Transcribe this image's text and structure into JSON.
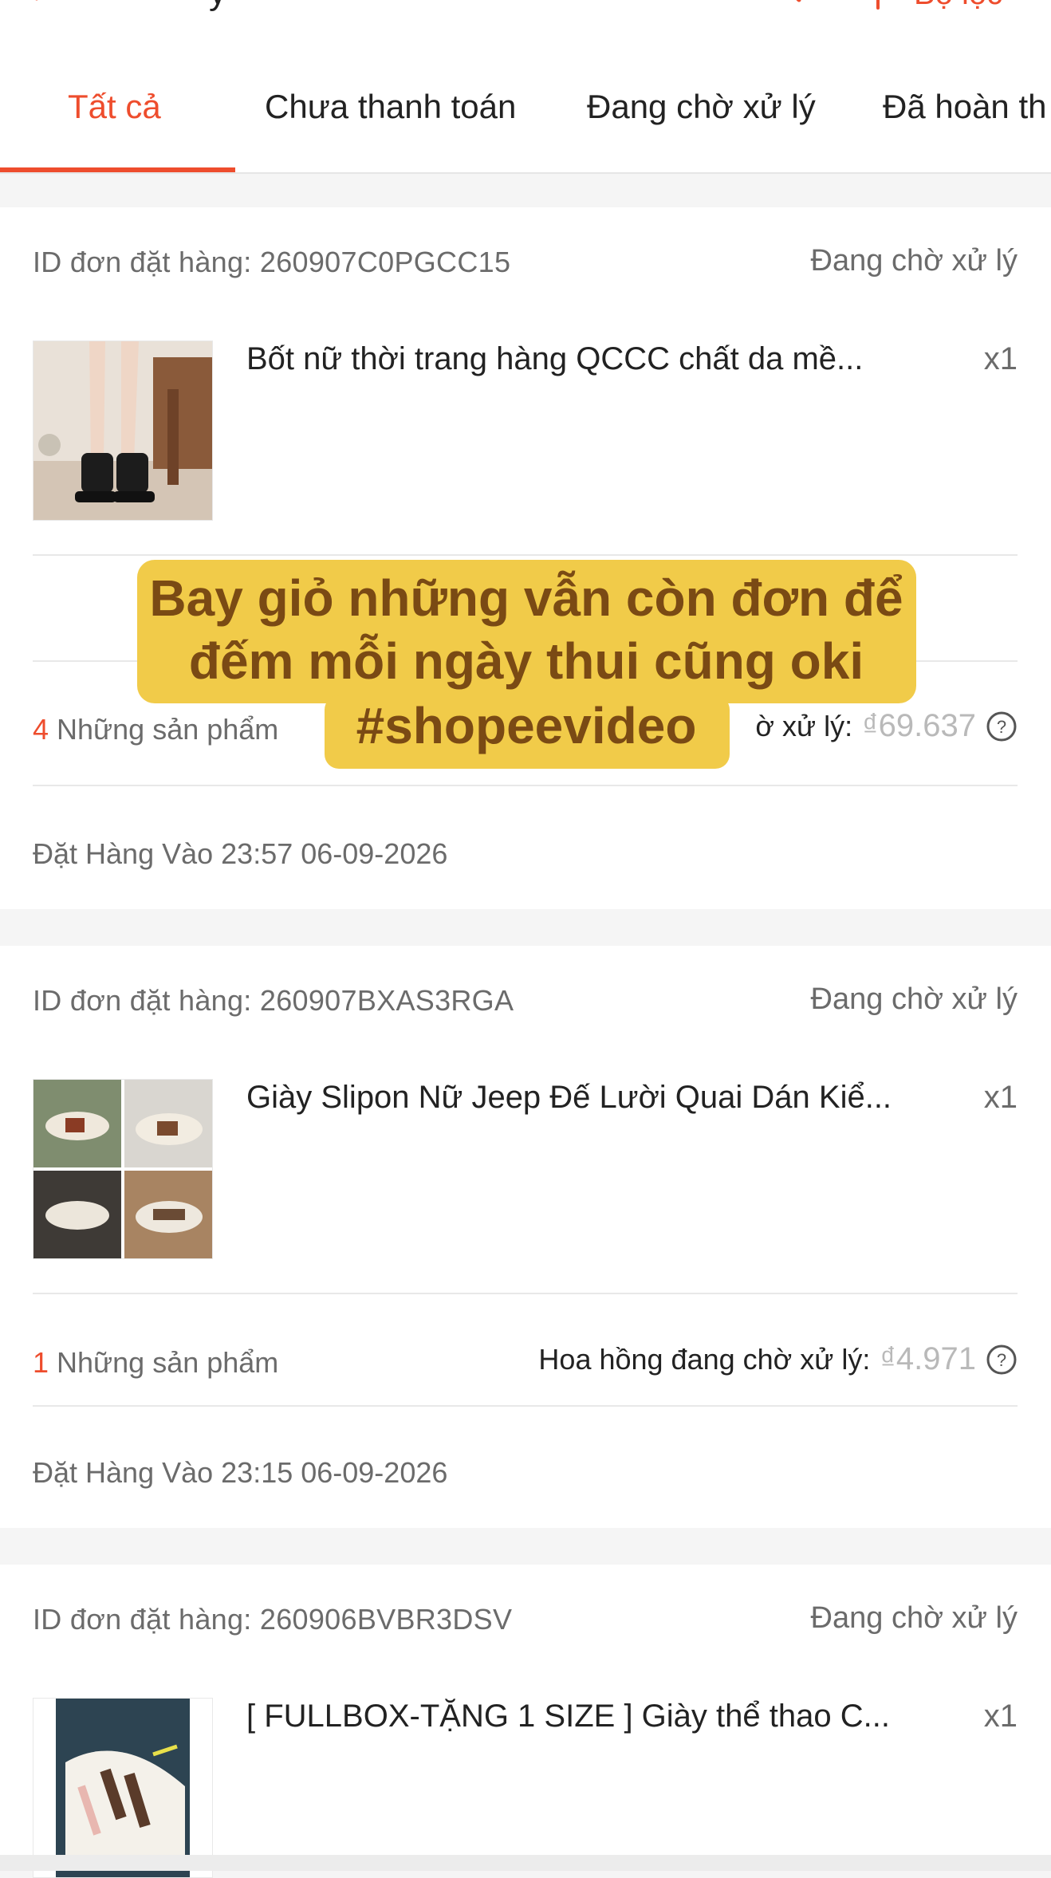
{
  "header": {
    "title_fragment": "y",
    "filter_label": "Bộ lọc"
  },
  "tabs": [
    {
      "label": "Tất cả",
      "active": true
    },
    {
      "label": "Chưa thanh toán",
      "active": false
    },
    {
      "label": "Đang chờ xử lý",
      "active": false
    },
    {
      "label": "Đã hoàn th",
      "active": false
    }
  ],
  "colors": {
    "accent": "#ee4d2d",
    "caption_bg": "#f1cb49",
    "caption_text": "#7a4a14"
  },
  "orders": [
    {
      "id_label": "ID đơn đặt hàng: 260907C0PGCC15",
      "status": "Đang chờ xử lý",
      "product_name": "Bốt nữ thời trang hàng QCCC chất da mề...",
      "qty": "x1",
      "count": "4",
      "count_label": " Những sản phẩm",
      "commission_label": "ờ xử lý:",
      "commission_amount": "₫69.637",
      "order_date": "Đặt Hàng Vào 23:57 06-09-2026"
    },
    {
      "id_label": "ID đơn đặt hàng: 260907BXAS3RGA",
      "status": "Đang chờ xử lý",
      "product_name": "Giày Slipon Nữ Jeep Đế Lười Quai Dán Kiể...",
      "qty": "x1",
      "count": "1",
      "count_label": " Những sản phẩm",
      "commission_label": "Hoa hồng đang chờ xử lý:",
      "commission_amount": "₫4.971",
      "order_date": "Đặt Hàng Vào 23:15 06-09-2026"
    },
    {
      "id_label": "ID đơn đặt hàng: 260906BVBR3DSV",
      "status": "Đang chờ xử lý",
      "product_name": "[ FULLBOX-TẶNG 1 SIZE ] Giày thể thao C...",
      "qty": "x1"
    }
  ],
  "caption": {
    "line1": "Bay giỏ những vẫn còn đơn để",
    "line2": "đếm mỗi ngày thui cũng oki",
    "line3": "#shopeevideo"
  }
}
